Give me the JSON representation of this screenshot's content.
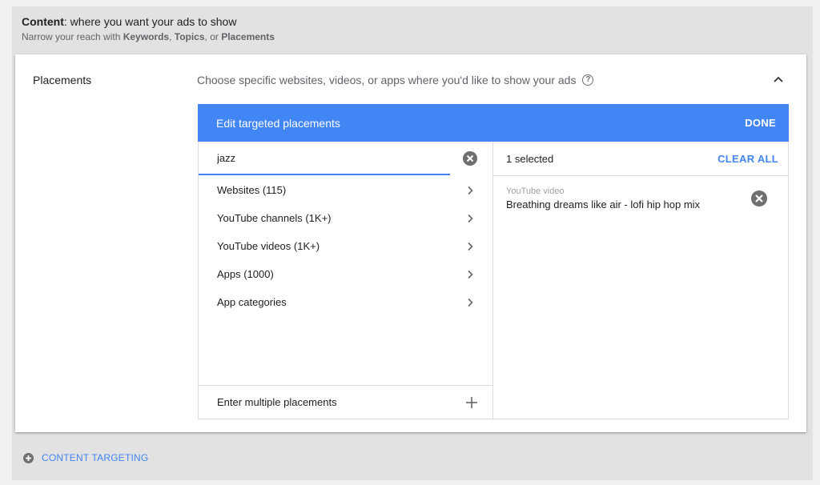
{
  "header": {
    "title_bold": "Content",
    "title_rest": ": where you want your ads to show",
    "sub_prefix": "Narrow your reach with ",
    "sub_keywords": "Keywords",
    "sub_sep1": ", ",
    "sub_topics": "Topics",
    "sub_sep2": ", or ",
    "sub_placements": "Placements"
  },
  "section": {
    "label": "Placements",
    "description": "Choose specific websites, videos, or apps where you'd like to show your ads",
    "help_icon": "help-circle-icon",
    "collapse_icon": "chevron-up-icon"
  },
  "editor": {
    "title": "Edit targeted placements",
    "done_label": "DONE",
    "accent": "#4285f4"
  },
  "search": {
    "value": "jazz",
    "clear_icon": "close-circle-icon"
  },
  "categories": [
    {
      "label": "Websites (115)"
    },
    {
      "label": "YouTube channels (1K+)"
    },
    {
      "label": "YouTube videos (1K+)"
    },
    {
      "label": "Apps (1000)"
    },
    {
      "label": "App categories"
    }
  ],
  "multiple": {
    "label": "Enter multiple placements"
  },
  "selected": {
    "count_label": "1 selected",
    "clear_all_label": "CLEAR ALL",
    "items": [
      {
        "type": "YouTube video",
        "name": "Breathing dreams like air - lofi hip hop mix"
      }
    ]
  },
  "footer": {
    "link_label": "CONTENT TARGETING"
  }
}
